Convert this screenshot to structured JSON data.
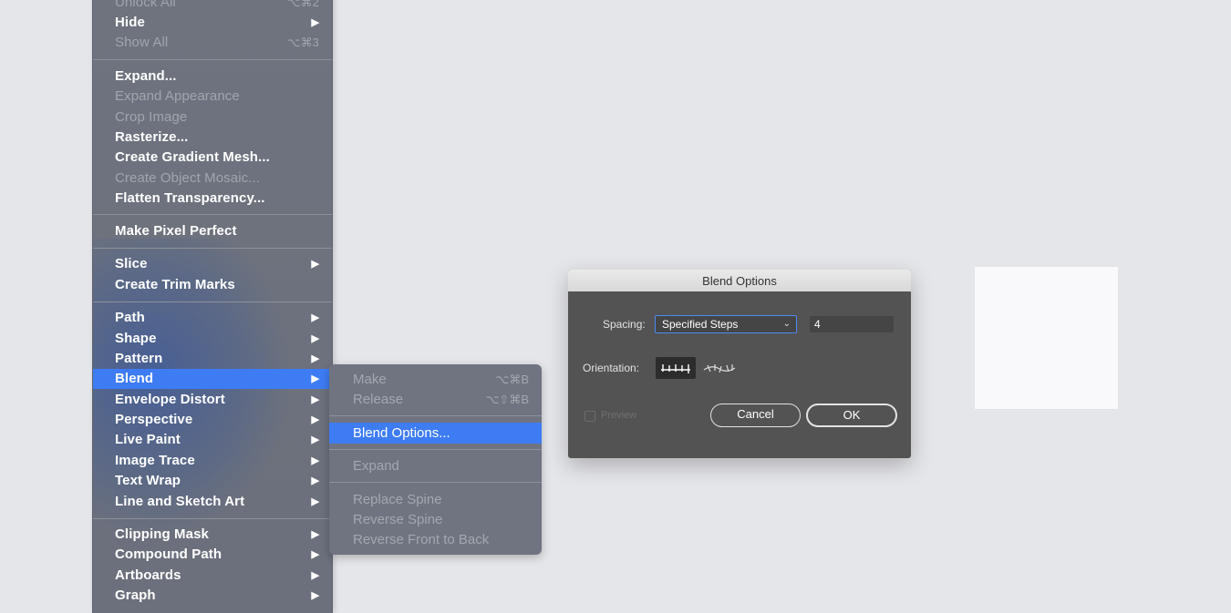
{
  "menu": {
    "items": [
      {
        "label": "Unlock All",
        "shortcut": "⌥⌘2",
        "disabled": true
      },
      {
        "label": "Hide",
        "arrow": true
      },
      {
        "label": "Show All",
        "shortcut": "⌥⌘3",
        "disabled": true
      },
      {
        "label": "Expand..."
      },
      {
        "label": "Expand Appearance",
        "disabled": true
      },
      {
        "label": "Crop Image",
        "disabled": true
      },
      {
        "label": "Rasterize..."
      },
      {
        "label": "Create Gradient Mesh..."
      },
      {
        "label": "Create Object Mosaic...",
        "disabled": true
      },
      {
        "label": "Flatten Transparency..."
      },
      {
        "label": "Make Pixel Perfect"
      },
      {
        "label": "Slice",
        "arrow": true
      },
      {
        "label": "Create Trim Marks"
      },
      {
        "label": "Path",
        "arrow": true
      },
      {
        "label": "Shape",
        "arrow": true
      },
      {
        "label": "Pattern",
        "arrow": true
      },
      {
        "label": "Blend",
        "arrow": true,
        "highlighted": true
      },
      {
        "label": "Envelope Distort",
        "arrow": true
      },
      {
        "label": "Perspective",
        "arrow": true
      },
      {
        "label": "Live Paint",
        "arrow": true
      },
      {
        "label": "Image Trace",
        "arrow": true
      },
      {
        "label": "Text Wrap",
        "arrow": true
      },
      {
        "label": "Line and Sketch Art",
        "arrow": true
      },
      {
        "label": "Clipping Mask",
        "arrow": true
      },
      {
        "label": "Compound Path",
        "arrow": true
      },
      {
        "label": "Artboards",
        "arrow": true
      },
      {
        "label": "Graph",
        "arrow": true
      }
    ]
  },
  "submenu": {
    "items": [
      {
        "label": "Make",
        "shortcut": "⌥⌘B"
      },
      {
        "label": "Release",
        "shortcut": "⌥⇧⌘B"
      },
      {
        "label": "Blend Options...",
        "highlighted": true
      },
      {
        "label": "Expand"
      },
      {
        "label": "Replace Spine"
      },
      {
        "label": "Reverse Spine"
      },
      {
        "label": "Reverse Front to Back"
      }
    ]
  },
  "dialog": {
    "title": "Blend Options",
    "spacing_label": "Spacing:",
    "spacing_value": "Specified Steps",
    "steps_value": "4",
    "orientation_label": "Orientation:",
    "preview_label": "Preview",
    "preview_checked": false,
    "cancel_label": "Cancel",
    "ok_label": "OK"
  },
  "colors": {
    "highlight": "#3e7cf4",
    "menu_bg": "#6e737e",
    "dialog_bg": "#535353"
  },
  "icons": {
    "submenu_arrow": "▶",
    "chevron": "⌄"
  }
}
